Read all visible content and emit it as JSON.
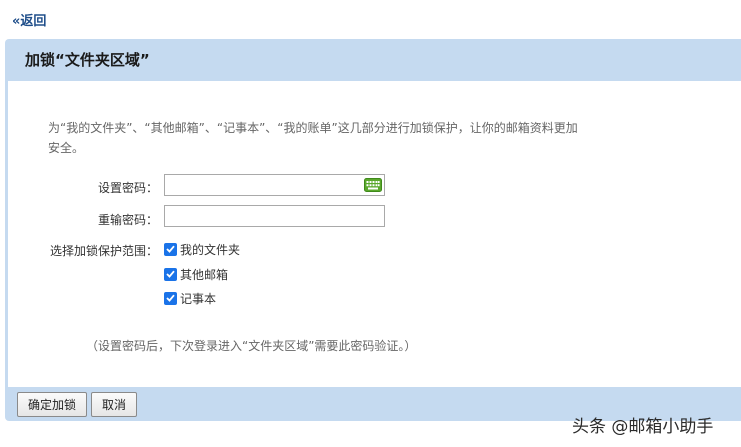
{
  "back_link": "«返回",
  "panel": {
    "title": "加锁“文件夹区域”"
  },
  "intro": "为“我的文件夹”、“其他邮箱”、“记事本”、“我的账单”这几部分进行加锁保护，让你的邮箱资料更加安全。",
  "form": {
    "password_label": "设置密码：",
    "password_value": "",
    "confirm_label": "重输密码：",
    "confirm_value": "",
    "scope_label": "选择加锁保护范围：",
    "scope_options": [
      {
        "label": "我的文件夹",
        "checked": true
      },
      {
        "label": "其他邮箱",
        "checked": true
      },
      {
        "label": "记事本",
        "checked": true
      }
    ]
  },
  "note": "（设置密码后，下次登录进入“文件夹区域”需要此密码验证。）",
  "buttons": {
    "confirm": "确定加锁",
    "cancel": "取消"
  },
  "watermark": "头条 @邮箱小助手",
  "colors": {
    "panel_bg": "#c5daf0",
    "checkbox": "#1a73e8",
    "link": "#1f4e8a",
    "keyboard_icon": "#5aa82c"
  },
  "icons": {
    "keyboard": "keyboard-icon",
    "check": "checkmark-icon"
  }
}
